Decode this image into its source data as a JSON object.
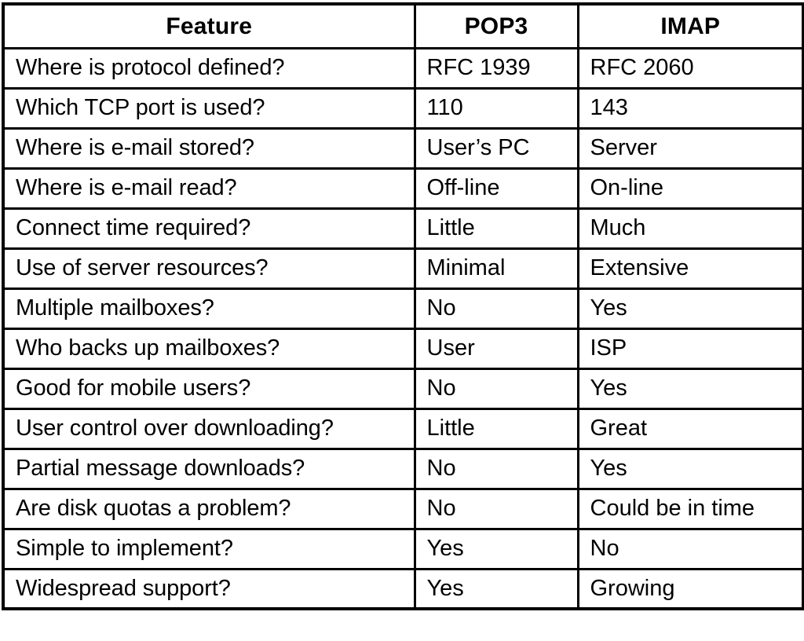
{
  "table": {
    "columns": [
      {
        "key": "feature",
        "label": "Feature",
        "align": "center"
      },
      {
        "key": "pop3",
        "label": "POP3",
        "align": "center"
      },
      {
        "key": "imap",
        "label": "IMAP",
        "align": "center"
      }
    ],
    "rows": [
      {
        "feature": "Where is protocol defined?",
        "pop3": "RFC 1939",
        "imap": "RFC 2060"
      },
      {
        "feature": "Which TCP port is used?",
        "pop3": "110",
        "imap": "143"
      },
      {
        "feature": "Where is e-mail stored?",
        "pop3": "User’s PC",
        "imap": "Server"
      },
      {
        "feature": "Where is e-mail read?",
        "pop3": "Off-line",
        "imap": "On-line"
      },
      {
        "feature": "Connect time required?",
        "pop3": "Little",
        "imap": "Much"
      },
      {
        "feature": "Use of server resources?",
        "pop3": "Minimal",
        "imap": "Extensive"
      },
      {
        "feature": "Multiple mailboxes?",
        "pop3": "No",
        "imap": "Yes"
      },
      {
        "feature": "Who backs up mailboxes?",
        "pop3": "User",
        "imap": "ISP"
      },
      {
        "feature": "Good for mobile users?",
        "pop3": "No",
        "imap": "Yes"
      },
      {
        "feature": "User control over downloading?",
        "pop3": "Little",
        "imap": "Great"
      },
      {
        "feature": "Partial message downloads?",
        "pop3": "No",
        "imap": "Yes"
      },
      {
        "feature": "Are disk quotas a problem?",
        "pop3": "No",
        "imap": "Could be in time"
      },
      {
        "feature": "Simple to implement?",
        "pop3": "Yes",
        "imap": "No"
      },
      {
        "feature": "Widespread support?",
        "pop3": "Yes",
        "imap": "Growing"
      }
    ]
  },
  "style": {
    "text_color": "#000000",
    "border_color": "#000000",
    "background_color": "#ffffff"
  }
}
